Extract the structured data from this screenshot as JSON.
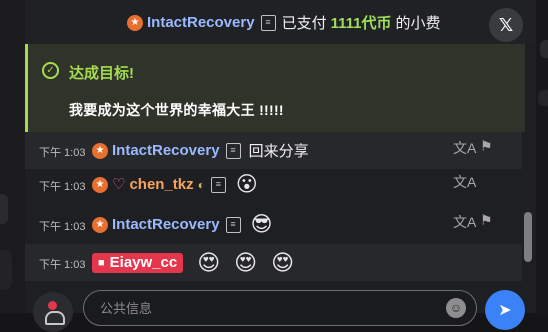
{
  "banner": {
    "user": "IntactRecovery",
    "paid_prefix": "已支付",
    "amount": "1111代币",
    "paid_suffix": "的小费",
    "close_icon": "x-close-icon"
  },
  "goal": {
    "icon": "target-icon",
    "title": "达成目标!",
    "text": "我要成为这个世界的幸福大王 !!!!!"
  },
  "messages": [
    {
      "time": "下午 1:03",
      "user": "IntactRecovery",
      "text": "回来分享",
      "highlight": true
    },
    {
      "time": "下午 1:03",
      "user": "chen_tkz",
      "emoji": "😮",
      "highlight": false
    },
    {
      "time": "下午 1:03",
      "user": "IntactRecovery",
      "emoji": "😎",
      "highlight": false
    },
    {
      "time": "下午 1:03",
      "user": "Eiayw_cc",
      "emojis": [
        "😍",
        "😍",
        "😍"
      ],
      "highlight": true
    }
  ],
  "input": {
    "placeholder": "公共信息",
    "value": ""
  },
  "colors": {
    "accent_green": "#a4dd4e",
    "username_blue": "#9ab9ff",
    "username_orange": "#f7a35c",
    "live_red": "#e4364d",
    "send_blue": "#3b82f6"
  }
}
